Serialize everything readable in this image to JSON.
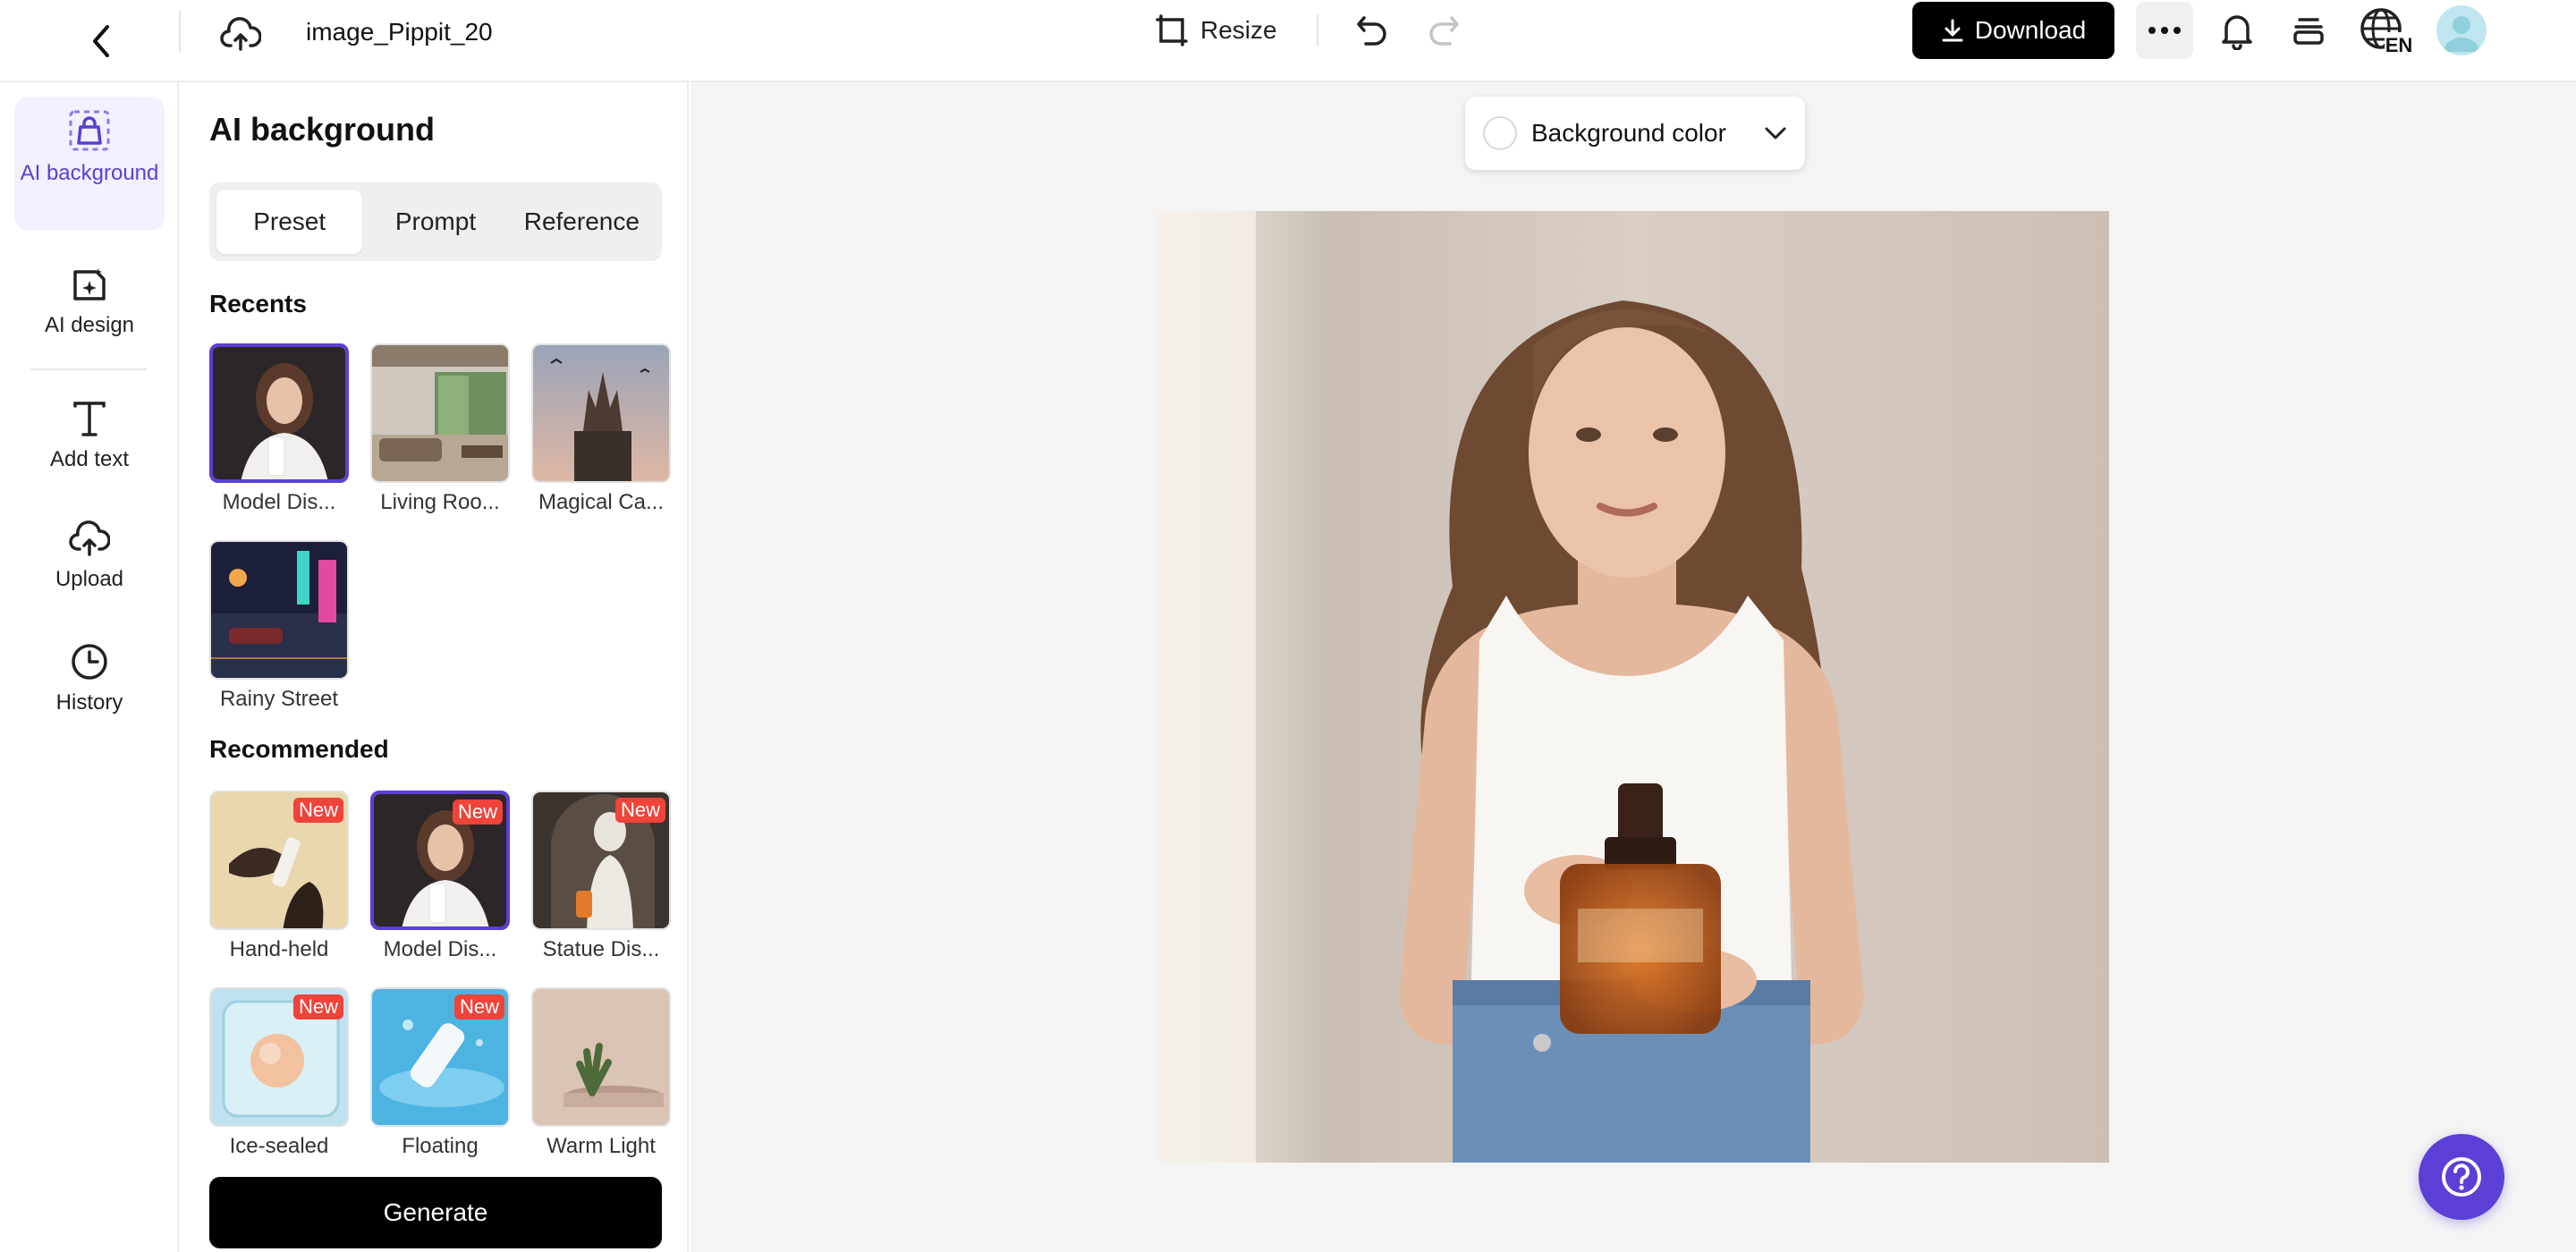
{
  "header": {
    "filename": "image_Pippit_20",
    "resize_label": "Resize",
    "download_label": "Download",
    "language_badge": "EN"
  },
  "rail": {
    "items": [
      {
        "label": "AI background",
        "icon": "ai-background-icon",
        "active": true
      },
      {
        "label": "AI design",
        "icon": "ai-design-icon"
      },
      {
        "label": "Add text",
        "icon": "text-icon"
      },
      {
        "label": "Upload",
        "icon": "upload-cloud-icon"
      },
      {
        "label": "History",
        "icon": "clock-icon"
      }
    ]
  },
  "panel": {
    "title": "AI background",
    "tabs": [
      {
        "label": "Preset",
        "active": true
      },
      {
        "label": "Prompt"
      },
      {
        "label": "Reference"
      }
    ],
    "recents_title": "Recents",
    "recents": [
      {
        "label": "Model Dis...",
        "selected": true
      },
      {
        "label": "Living Roo..."
      },
      {
        "label": "Magical Ca..."
      },
      {
        "label": "Rainy Street"
      }
    ],
    "recommended_title": "Recommended",
    "recommended": [
      {
        "label": "Hand-held",
        "badge": "New"
      },
      {
        "label": "Model Dis...",
        "badge": "New",
        "selected": true
      },
      {
        "label": "Statue Dis...",
        "badge": "New"
      },
      {
        "label": "Ice-sealed",
        "badge": "New"
      },
      {
        "label": "Floating",
        "badge": "New"
      },
      {
        "label": "Warm Light"
      }
    ],
    "generate_label": "Generate"
  },
  "canvas": {
    "background_color_label": "Background color"
  },
  "colors": {
    "accent": "#5b3fd6",
    "primary_button": "#000000",
    "new_badge": "#f0433a",
    "canvas_bg": "#f4f4f5"
  }
}
